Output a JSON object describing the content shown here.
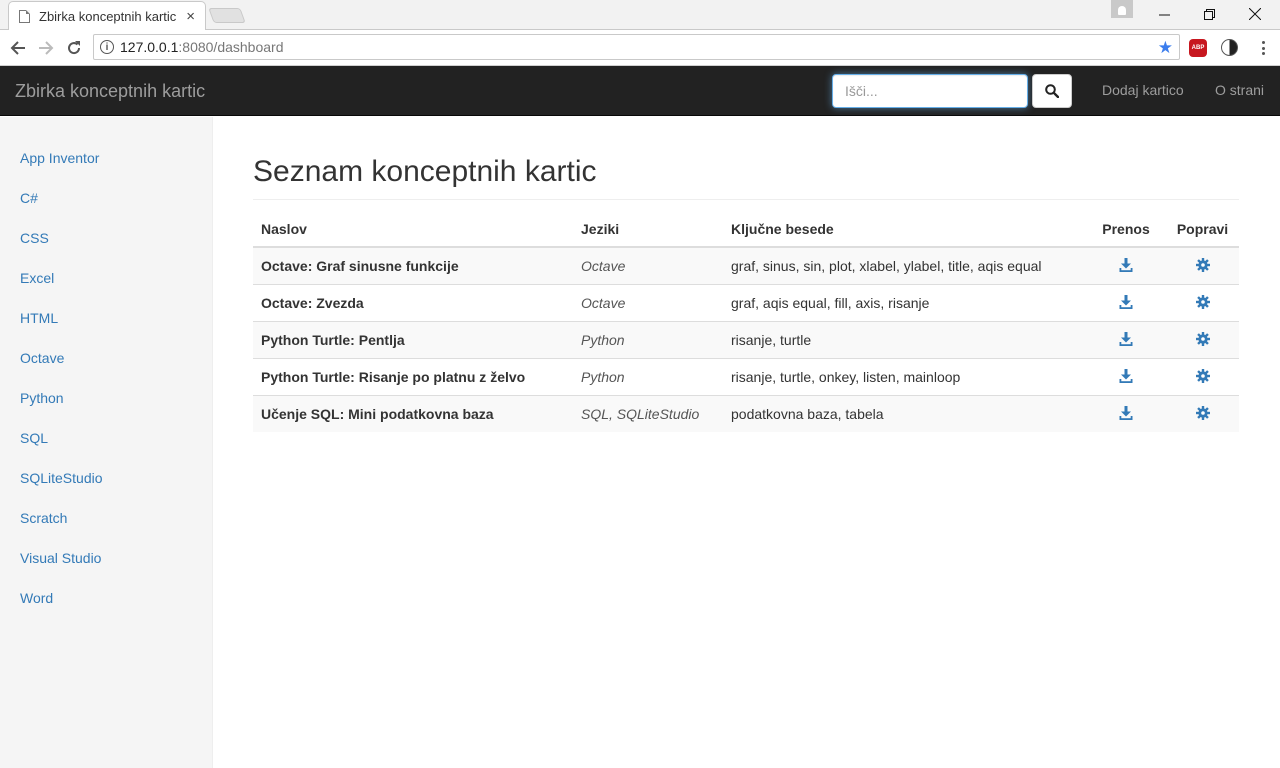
{
  "browser": {
    "tab_title": "Zbirka konceptnih kartic",
    "tab_close": "×",
    "url_host": "127.0.0.1",
    "url_rest": ":8080/dashboard",
    "abp_label": "ABP"
  },
  "navbar": {
    "brand": "Zbirka konceptnih kartic",
    "search_placeholder": "Išči...",
    "links": [
      "Dodaj kartico",
      "O strani"
    ]
  },
  "sidebar": {
    "items": [
      "App Inventor",
      "C#",
      "CSS",
      "Excel",
      "HTML",
      "Octave",
      "Python",
      "SQL",
      "SQLiteStudio",
      "Scratch",
      "Visual Studio",
      "Word"
    ]
  },
  "main": {
    "title": "Seznam konceptnih kartic",
    "columns": [
      "Naslov",
      "Jeziki",
      "Ključne besede",
      "Prenos",
      "Popravi"
    ],
    "rows": [
      {
        "naslov": "Octave: Graf sinusne funkcije",
        "jeziki": "Octave",
        "besede": "graf, sinus, sin, plot, xlabel, ylabel, title, aqis equal"
      },
      {
        "naslov": "Octave: Zvezda",
        "jeziki": "Octave",
        "besede": "graf, aqis equal, fill, axis, risanje"
      },
      {
        "naslov": "Python Turtle: Pentlja",
        "jeziki": "Python",
        "besede": "risanje, turtle"
      },
      {
        "naslov": "Python Turtle: Risanje po platnu z želvo",
        "jeziki": "Python",
        "besede": "risanje, turtle, onkey, listen, mainloop"
      },
      {
        "naslov": "Učenje SQL: Mini podatkovna baza",
        "jeziki": "SQL, SQLiteStudio",
        "besede": "podatkovna baza, tabela"
      }
    ]
  },
  "colors": {
    "link": "#337ab7",
    "navbar_bg": "#222222",
    "sidebar_bg": "#f5f5f5"
  }
}
